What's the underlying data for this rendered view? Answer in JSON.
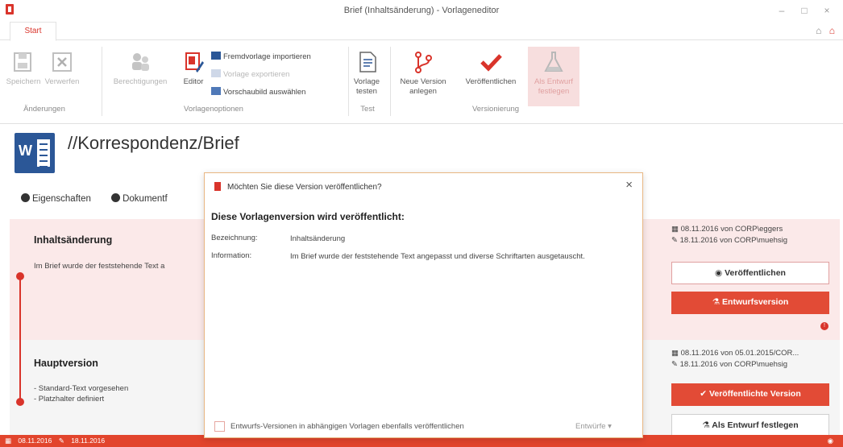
{
  "window": {
    "title": "Brief (Inhaltsänderung) - Vorlageneditor",
    "controls": [
      "–",
      "□",
      "×"
    ]
  },
  "ribbon": {
    "tab": "Start",
    "groups": {
      "aenderungen": {
        "label": "Änderungen",
        "buttons": [
          "Speichern",
          "Verwerfen"
        ]
      },
      "vorlagenoptionen": {
        "label": "Vorlagenoptionen",
        "buttons": [
          "Berechtigungen",
          "Editor"
        ],
        "small_buttons": [
          "Fremdvorlage importieren",
          "Vorlage exportieren",
          "Vorschaubild auswählen"
        ]
      },
      "test": {
        "label": "Test",
        "buttons": [
          "Vorlage testen"
        ]
      },
      "versionierung": {
        "label": "Versionierung",
        "buttons": [
          "Neue Version anlegen",
          "Veröffentlichen",
          "Als Entwurf festlegen"
        ]
      }
    }
  },
  "header": {
    "path": "//Korrespondenz/Brief",
    "subtabs": [
      "Eigenschaften",
      "Dokumentf"
    ]
  },
  "versions": [
    {
      "title": "Inhaltsänderung",
      "text": "Im Brief wurde der feststehende Text a",
      "meta": [
        "08.11.2016 von CORP\\eggers",
        "18.11.2016 von CORP\\muehsig"
      ],
      "buttons": [
        "Veröffentlichen",
        "Entwurfsversion"
      ]
    },
    {
      "title": "Hauptversion",
      "text": [
        "- Standard-Text vorgesehen",
        "- Platzhalter definiert"
      ],
      "meta": [
        "08.11.2016 von 05.01.2015/COR...",
        "18.11.2016 von CORP\\muehsig"
      ],
      "buttons": [
        "Veröffentlichte Version",
        "Als Entwurf festlegen"
      ]
    }
  ],
  "statusbar": {
    "created": "08.11.2016",
    "modified": "18.11.2016"
  },
  "dialog": {
    "title": "Möchten Sie diese Version veröffentlichen?",
    "heading": "Diese Vorlagenversion wird veröffentlicht:",
    "fields": [
      {
        "label": "Bezeichnung:",
        "value": "Inhaltsänderung"
      },
      {
        "label": "Information:",
        "value": "Im Brief wurde der feststehende Text angepasst und diverse Schriftarten ausgetauscht."
      }
    ],
    "checkbox_label": "Entwurfs-Versionen in abhängigen Vorlagen ebenfalls veröffentlichen",
    "dropdown": "Entwürfe",
    "close": "×"
  },
  "colors": {
    "accent": "#e2452d",
    "brand_word": "#2b5797",
    "highlight": "#fbe9e9"
  }
}
